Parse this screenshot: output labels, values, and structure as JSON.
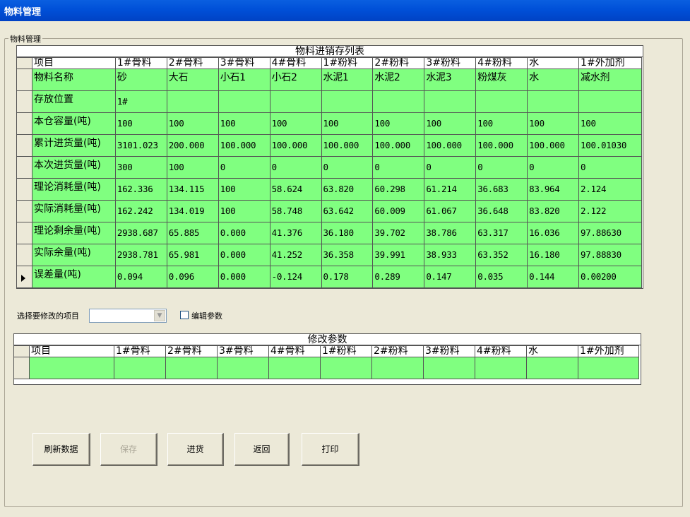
{
  "window": {
    "title": "物料管理"
  },
  "group": {
    "legend": "物料管理"
  },
  "inventory": {
    "caption": "物料进销存列表",
    "columns": [
      "项目",
      "1#骨料",
      "2#骨料",
      "3#骨料",
      "4#骨料",
      "1#粉料",
      "2#粉料",
      "3#粉料",
      "4#粉料",
      "水",
      "1#外加剂"
    ],
    "rows": [
      {
        "label": "物料名称",
        "values": [
          "砂",
          "大石",
          "小石1",
          "小石2",
          "水泥1",
          "水泥2",
          "水泥3",
          "粉煤灰",
          "水",
          "减水剂"
        ]
      },
      {
        "label": "存放位置",
        "values": [
          "1#",
          "",
          "",
          "",
          "",
          "",
          "",
          "",
          "",
          ""
        ]
      },
      {
        "label": "本仓容量(吨)",
        "values": [
          "100",
          "100",
          "100",
          "100",
          "100",
          "100",
          "100",
          "100",
          "100",
          "100"
        ]
      },
      {
        "label": "累计进货量(吨)",
        "values": [
          "3101.023",
          "200.000",
          "100.000",
          "100.000",
          "100.000",
          "100.000",
          "100.000",
          "100.000",
          "100.000",
          "100.01030"
        ]
      },
      {
        "label": "本次进货量(吨)",
        "values": [
          "300",
          "100",
          "0",
          "0",
          "0",
          "0",
          "0",
          "0",
          "0",
          "0"
        ]
      },
      {
        "label": "理论消耗量(吨)",
        "values": [
          "162.336",
          "134.115",
          "100",
          "58.624",
          "63.820",
          "60.298",
          "61.214",
          "36.683",
          "83.964",
          "2.124"
        ]
      },
      {
        "label": "实际消耗量(吨)",
        "values": [
          "162.242",
          "134.019",
          "100",
          "58.748",
          "63.642",
          "60.009",
          "61.067",
          "36.648",
          "83.820",
          "2.122"
        ]
      },
      {
        "label": "理论剩余量(吨)",
        "values": [
          "2938.687",
          "65.885",
          "0.000",
          "41.376",
          "36.180",
          "39.702",
          "38.786",
          "63.317",
          "16.036",
          "97.88630"
        ]
      },
      {
        "label": "实际余量(吨)",
        "values": [
          "2938.781",
          "65.981",
          "0.000",
          "41.252",
          "36.358",
          "39.991",
          "38.933",
          "63.352",
          "16.180",
          "97.88830"
        ]
      },
      {
        "label": "误差量(吨)",
        "values": [
          "0.094",
          "0.096",
          "0.000",
          "-0.124",
          "0.178",
          "0.289",
          "0.147",
          "0.035",
          "0.144",
          "0.00200"
        ]
      }
    ]
  },
  "controls": {
    "select_label": "选择要修改的项目",
    "select_value": "",
    "edit_checkbox_label": "编辑参数",
    "edit_checked": false
  },
  "params": {
    "caption": "修改参数",
    "columns": [
      "项目",
      "1#骨料",
      "2#骨料",
      "3#骨料",
      "4#骨料",
      "1#粉料",
      "2#粉料",
      "3#粉料",
      "4#粉料",
      "水",
      "1#外加剂"
    ]
  },
  "buttons": {
    "refresh": "刷新数据",
    "save": "保存",
    "purchase": "进货",
    "back": "返回",
    "print": "打印"
  },
  "colors": {
    "grid_fill": "#80ff80",
    "titlebar": "#0050d8"
  }
}
